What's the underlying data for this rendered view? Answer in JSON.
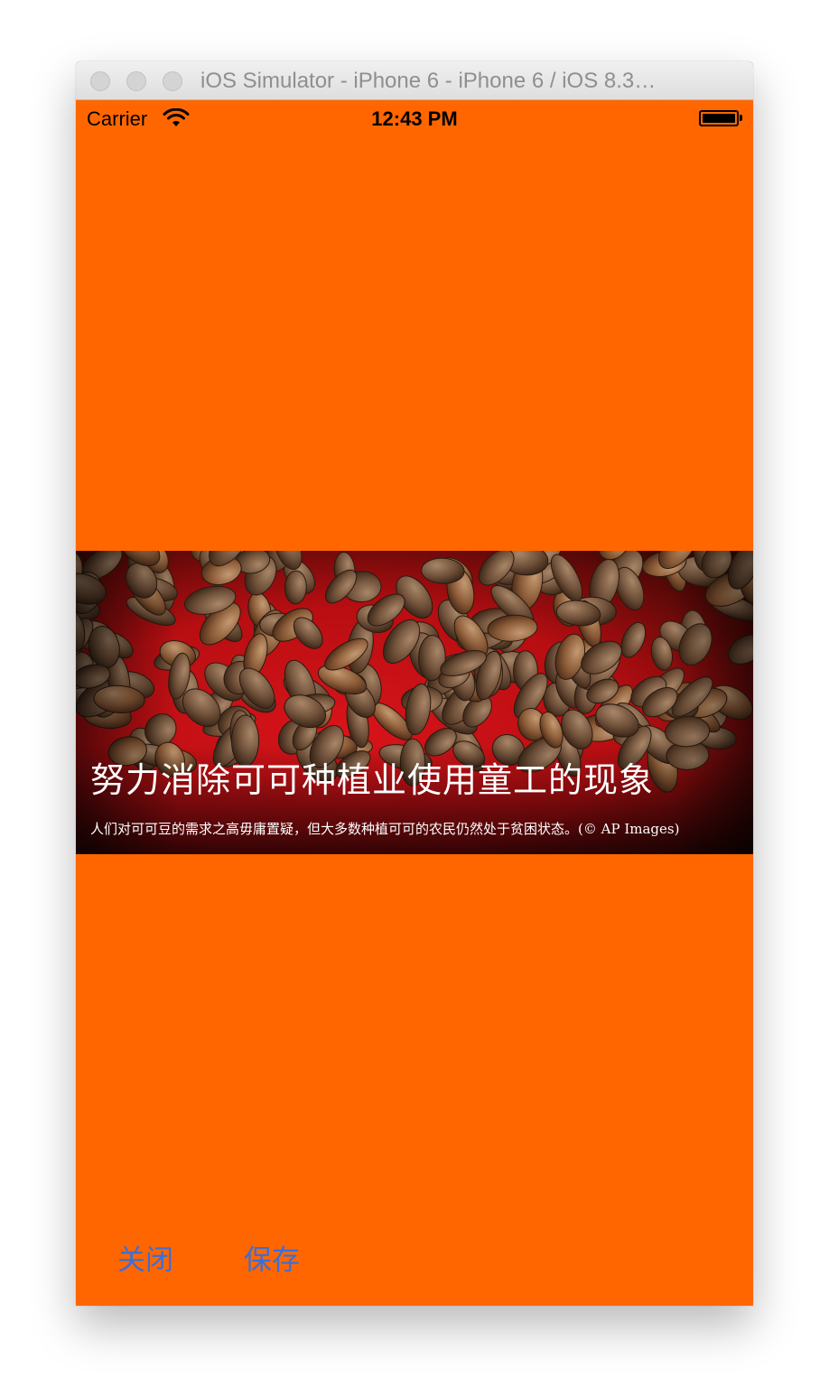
{
  "window": {
    "title": "iOS Simulator - iPhone 6 - iPhone 6 / iOS 8.3…"
  },
  "statusbar": {
    "carrier": "Carrier",
    "time": "12:43 PM",
    "battery_level": 1.0,
    "icons": [
      "wifi-icon",
      "battery-icon"
    ]
  },
  "article_card": {
    "headline": "努力消除可可种植业使用童工的现象",
    "caption": "人们对可可豆的需求之高毋庸置疑，但大多数种植可可的农民仍然处于贫困状态。(© AP Images)"
  },
  "toolbar": {
    "close_label": "关闭",
    "save_label": "保存"
  },
  "colors": {
    "background": "#ff6600",
    "button_text": "#3a6fd8",
    "caption_text": "#ffffff"
  }
}
